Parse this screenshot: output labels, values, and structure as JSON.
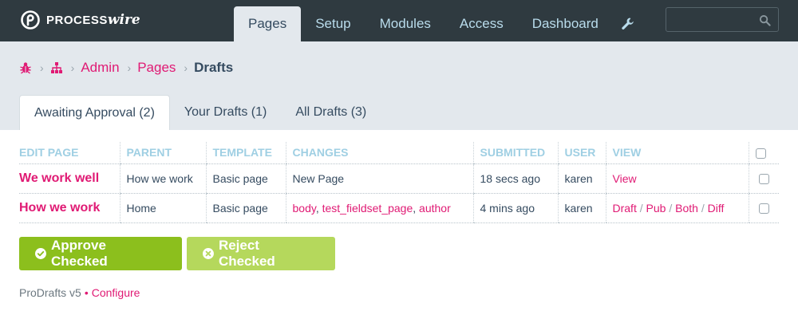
{
  "header": {
    "logo": {
      "wordmark_a": "PROCESS",
      "wordmark_b": "wire"
    },
    "nav": [
      {
        "label": "Pages",
        "active": true
      },
      {
        "label": "Setup",
        "active": false
      },
      {
        "label": "Modules",
        "active": false
      },
      {
        "label": "Access",
        "active": false
      },
      {
        "label": "Dashboard",
        "active": false
      }
    ],
    "tools_icon": "wrench-icon",
    "search": {
      "placeholder": "",
      "value": ""
    }
  },
  "breadcrumbs": {
    "icons": [
      "bug-icon",
      "sitemap-icon"
    ],
    "items": [
      "Admin",
      "Pages"
    ],
    "current": "Drafts"
  },
  "tabs": [
    {
      "label": "Awaiting Approval (2)",
      "active": true
    },
    {
      "label": "Your Drafts (1)",
      "active": false
    },
    {
      "label": "All Drafts (3)",
      "active": false
    }
  ],
  "table": {
    "columns": [
      "EDIT PAGE",
      "PARENT",
      "TEMPLATE",
      "CHANGES",
      "SUBMITTED",
      "USER",
      "VIEW"
    ],
    "rows": [
      {
        "title": "We work well",
        "parent": "How we work",
        "template": "Basic page",
        "changes_text": "New Page",
        "submitted": "18 secs ago",
        "user": "karen",
        "view_link": "View"
      },
      {
        "title": "How we work",
        "parent": "Home",
        "template": "Basic page",
        "changes_links": [
          "body",
          "test_fieldset_page",
          "author"
        ],
        "submitted": "4 mins ago",
        "user": "karen",
        "view_links": [
          "Draft",
          "Pub",
          "Both",
          "Diff"
        ]
      }
    ]
  },
  "buttons": {
    "approve": "Approve Checked",
    "reject": "Reject Checked"
  },
  "footer": {
    "version": "ProDrafts v5",
    "bullet": "•",
    "configure": "Configure"
  },
  "colors": {
    "accent": "#e01a74",
    "masthead": "#2f3a40",
    "band": "#e3e8ed",
    "approve": "#8cbf1d",
    "reject": "#b5d85c",
    "table_header": "#9fcfe3"
  }
}
